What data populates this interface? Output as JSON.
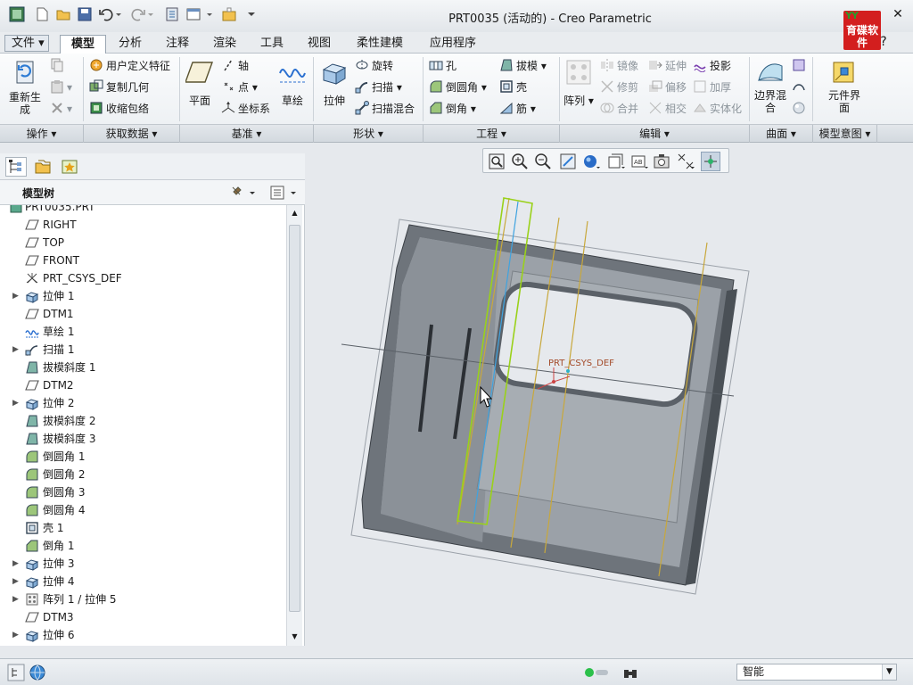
{
  "window": {
    "title": "PRT0035 (活动的) - Creo Parametric",
    "brand_logo_text": "育碟软件",
    "brand_top": "YY"
  },
  "menu": {
    "file_label": "文件",
    "tabs": [
      "模型",
      "分析",
      "注释",
      "渲染",
      "工具",
      "视图",
      "柔性建模",
      "应用程序"
    ],
    "active_tab": "模型"
  },
  "ribbon": {
    "operations": {
      "regenerate_label": "重新生成",
      "group": "操作"
    },
    "get_data": {
      "udf_label": "用户定义特征",
      "copy_geom_label": "复制几何",
      "shrinkwrap_label": "收缩包络",
      "group": "获取数据"
    },
    "datum": {
      "plane_label": "平面",
      "axis_label": "轴",
      "point_label": "点",
      "csys_label": "坐标系",
      "sketch_label": "草绘",
      "group": "基准"
    },
    "shapes": {
      "extrude_label": "拉伸",
      "revolve_label": "旋转",
      "sweep_label": "扫描",
      "swept_blend_label": "扫描混合",
      "group": "形状"
    },
    "engineering": {
      "hole_label": "孔",
      "round_label": "倒圆角",
      "chamfer_label": "倒角",
      "draft_label": "拔模",
      "shell_label": "壳",
      "rib_label": "筋",
      "group": "工程"
    },
    "editing": {
      "pattern_label": "阵列",
      "mirror_label": "镜像",
      "trim_label": "修剪",
      "merge_label": "合并",
      "extend_label": "延伸",
      "offset_label": "偏移",
      "intersect_label": "相交",
      "project_label": "投影",
      "thicken_label": "加厚",
      "solidify_label": "实体化",
      "group": "编辑"
    },
    "surfaces": {
      "boundary_blend_label": "边界混合",
      "group": "曲面"
    },
    "model_intent": {
      "component_interface_label": "元件界面",
      "group": "模型意图"
    }
  },
  "model_tree": {
    "header": "模型树",
    "items": [
      {
        "label": "PRT0035.PRT",
        "icon": "part-icon",
        "expander": false
      },
      {
        "label": "RIGHT",
        "icon": "datum-plane-icon",
        "expander": false
      },
      {
        "label": "TOP",
        "icon": "datum-plane-icon",
        "expander": false
      },
      {
        "label": "FRONT",
        "icon": "datum-plane-icon",
        "expander": false
      },
      {
        "label": "PRT_CSYS_DEF",
        "icon": "csys-icon",
        "expander": false
      },
      {
        "label": "拉伸 1",
        "icon": "extrude-icon",
        "expander": true
      },
      {
        "label": "DTM1",
        "icon": "datum-plane-icon",
        "expander": false
      },
      {
        "label": "草绘 1",
        "icon": "sketch-icon",
        "expander": false
      },
      {
        "label": "扫描 1",
        "icon": "sweep-icon",
        "expander": true
      },
      {
        "label": "拔模斜度 1",
        "icon": "draft-icon",
        "expander": false
      },
      {
        "label": "DTM2",
        "icon": "datum-plane-icon",
        "expander": false
      },
      {
        "label": "拉伸 2",
        "icon": "extrude-icon",
        "expander": true
      },
      {
        "label": "拔模斜度 2",
        "icon": "draft-icon",
        "expander": false
      },
      {
        "label": "拔模斜度 3",
        "icon": "draft-icon",
        "expander": false
      },
      {
        "label": "倒圆角 1",
        "icon": "round-icon",
        "expander": false
      },
      {
        "label": "倒圆角 2",
        "icon": "round-icon",
        "expander": false
      },
      {
        "label": "倒圆角 3",
        "icon": "round-icon",
        "expander": false
      },
      {
        "label": "倒圆角 4",
        "icon": "round-icon",
        "expander": false
      },
      {
        "label": "壳 1",
        "icon": "shell-icon",
        "expander": false
      },
      {
        "label": "倒角 1",
        "icon": "chamfer-icon",
        "expander": false
      },
      {
        "label": "拉伸 3",
        "icon": "extrude-icon",
        "expander": true
      },
      {
        "label": "拉伸 4",
        "icon": "extrude-icon",
        "expander": true
      },
      {
        "label": "阵列 1 / 拉伸 5",
        "icon": "pattern-icon",
        "expander": true
      },
      {
        "label": "DTM3",
        "icon": "datum-plane-icon",
        "expander": false
      },
      {
        "label": "拉伸 6",
        "icon": "extrude-icon",
        "expander": true
      }
    ]
  },
  "viewport": {
    "csys_label": "PRT_CSYS_DEF"
  },
  "status": {
    "filter_value": "智能"
  },
  "colors": {
    "accent": "#3a6ea5",
    "model_body": "#8a9097",
    "datum_plane_edge": "#c8a83c",
    "selected_edge": "#9ad11a",
    "logo_red": "#d31e1e"
  }
}
